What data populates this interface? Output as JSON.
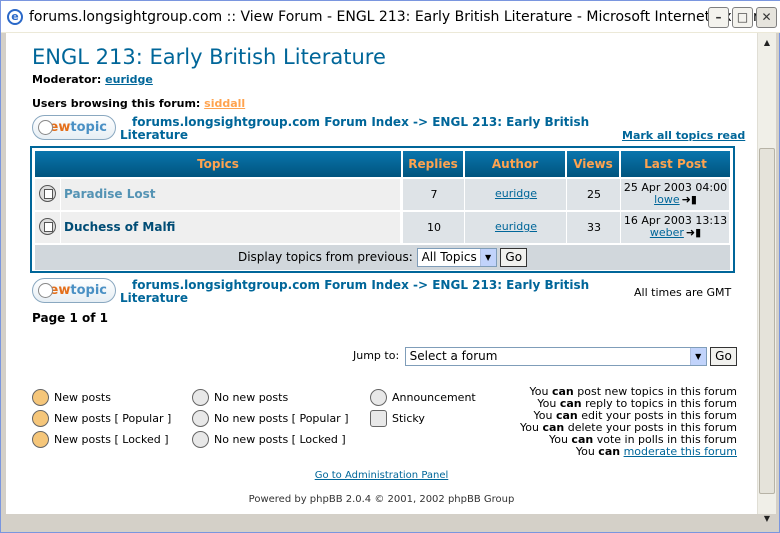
{
  "window": {
    "title": "forums.longsightgroup.com :: View Forum - ENGL 213: Early British Literature - Microsoft Internet Explorer",
    "minimize": "–",
    "maximize": "□",
    "close": "✕"
  },
  "forum": {
    "title": "ENGL 213: Early British Literature",
    "moderator_label": "Moderator:",
    "moderator": "euridge",
    "browsing_label": "Users browsing this forum:",
    "browsing_user": "siddall",
    "mark_all": "Mark all topics read",
    "new_topic_new": "new",
    "new_topic_topic": "topic",
    "nav_index": "forums.longsightgroup.com Forum Index",
    "nav_sep": "->",
    "nav_forum_line1": "ENGL 213: Early British",
    "nav_forum_line2": "Literature"
  },
  "table": {
    "headers": [
      "Topics",
      "Replies",
      "Author",
      "Views",
      "Last Post"
    ],
    "rows": [
      {
        "title": "Paradise Lost",
        "replies": "7",
        "author": "euridge",
        "views": "25",
        "last_date": "25 Apr 2003 04:00",
        "last_user": "lowe"
      },
      {
        "title": "Duchess of Malfi",
        "replies": "10",
        "author": "euridge",
        "views": "33",
        "last_date": "16 Apr 2003 13:13",
        "last_user": "weber"
      }
    ],
    "display_label": "Display topics from previous:",
    "display_value": "All Topics",
    "go": "Go"
  },
  "footer": {
    "timezone": "All times are GMT",
    "page": "Page 1 of 1",
    "jump_label": "Jump to:",
    "jump_value": "Select a forum",
    "jump_go": "Go",
    "legend": [
      "New posts",
      "No new posts",
      "Announcement",
      "New posts [ Popular ]",
      "No new posts [ Popular ]",
      "Sticky",
      "New posts [ Locked ]",
      "No new posts [ Locked ]"
    ],
    "permissions": [
      {
        "pre": "You ",
        "can": "can",
        "post": " post new topics in this forum"
      },
      {
        "pre": "You ",
        "can": "can",
        "post": " reply to topics in this forum"
      },
      {
        "pre": "You ",
        "can": "can",
        "post": " edit your posts in this forum"
      },
      {
        "pre": "You ",
        "can": "can",
        "post": " delete your posts in this forum"
      },
      {
        "pre": "You ",
        "can": "can",
        "post": " vote in polls in this forum"
      },
      {
        "pre": "You ",
        "can": "can",
        "post": " "
      }
    ],
    "moderate_link": "moderate this forum",
    "admin_link": "Go to Administration Panel",
    "powered": "Powered by phpBB 2.0.4 © 2001, 2002 phpBB Group"
  }
}
